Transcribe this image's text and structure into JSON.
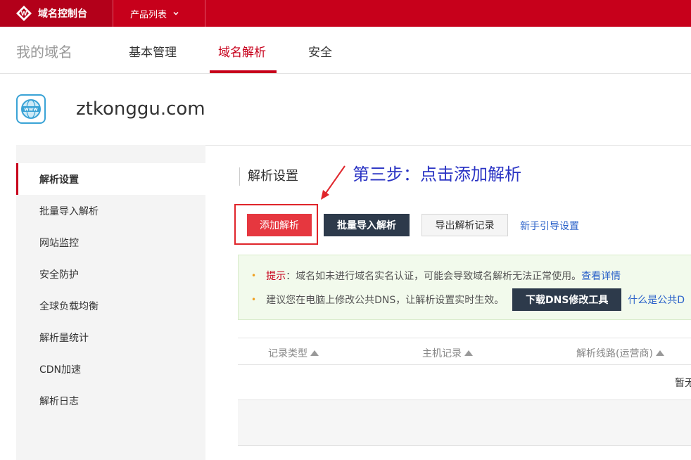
{
  "topbar": {
    "brand_label": "域名控制台",
    "product_menu_label": "产品列表",
    "brand_color": "#c7001b"
  },
  "nav": {
    "my_domains": "我的域名",
    "tabs": [
      {
        "label": "基本管理",
        "active": false
      },
      {
        "label": "域名解析",
        "active": true
      },
      {
        "label": "安全",
        "active": false
      }
    ]
  },
  "domain": {
    "icon_text": "www",
    "name": "ztkonggu.com"
  },
  "sidebar": {
    "items": [
      {
        "label": "解析设置",
        "active": true
      },
      {
        "label": "批量导入解析",
        "active": false
      },
      {
        "label": "网站监控",
        "active": false
      },
      {
        "label": "安全防护",
        "active": false
      },
      {
        "label": "全球负载均衡",
        "active": false
      },
      {
        "label": "解析量统计",
        "active": false
      },
      {
        "label": "CDN加速",
        "active": false
      },
      {
        "label": "解析日志",
        "active": false
      }
    ]
  },
  "main": {
    "section_title": "解析设置",
    "annotation": "第三步：点击添加解析",
    "buttons": {
      "add": "添加解析",
      "bulk_import": "批量导入解析",
      "export": "导出解析记录",
      "guide_link": "新手引导设置"
    },
    "notice": {
      "tip_label": "提示",
      "tip_text": "：域名如未进行域名实名认证，可能会导致域名解析无法正常使用。",
      "tip_link": "查看详情",
      "dns_text": "建议您在电脑上修改公共DNS，让解析设置实时生效。",
      "dns_button": "下载DNS修改工具",
      "dns_link": "什么是公共D"
    },
    "table": {
      "columns": [
        "记录类型",
        "主机记录",
        "解析线路(运营商)"
      ],
      "empty_text": "暂无"
    }
  }
}
